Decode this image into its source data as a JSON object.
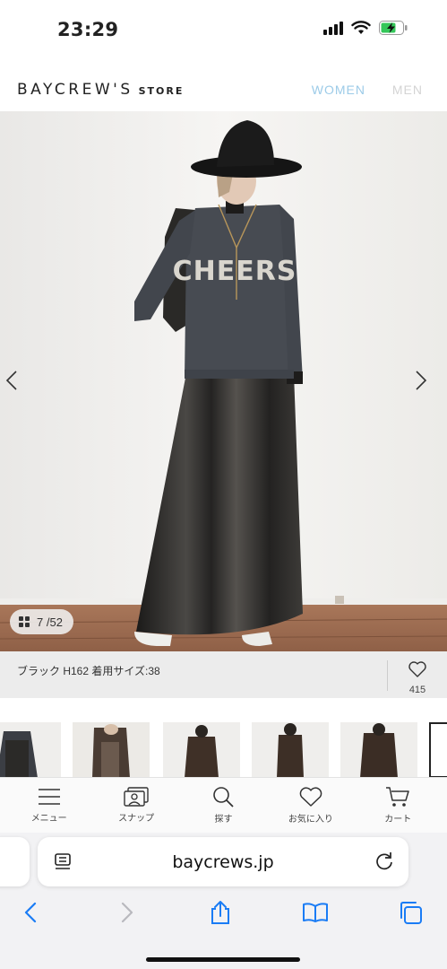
{
  "status_bar": {
    "time": "23:29"
  },
  "header": {
    "logo_main": "BAYCREW'S",
    "logo_sub": "STORE",
    "nav_women": "WOMEN",
    "nav_men": "MEN"
  },
  "gallery": {
    "current": "7",
    "total": "/52",
    "caption": "ブラック H162 着用サイズ:38",
    "likes": "415",
    "shirt_text": "CHEERS"
  },
  "app_menu": {
    "items": [
      {
        "label": "メニュー",
        "icon": "menu-icon"
      },
      {
        "label": "スナップ",
        "icon": "snap-icon"
      },
      {
        "label": "探す",
        "icon": "search-icon"
      },
      {
        "label": "お気に入り",
        "icon": "heart-icon"
      },
      {
        "label": "カート",
        "icon": "cart-icon"
      }
    ]
  },
  "browser": {
    "url": "baycrews.jp"
  },
  "colors": {
    "accent": "#9ccbe8",
    "ios_blue": "#1a7cf5"
  }
}
